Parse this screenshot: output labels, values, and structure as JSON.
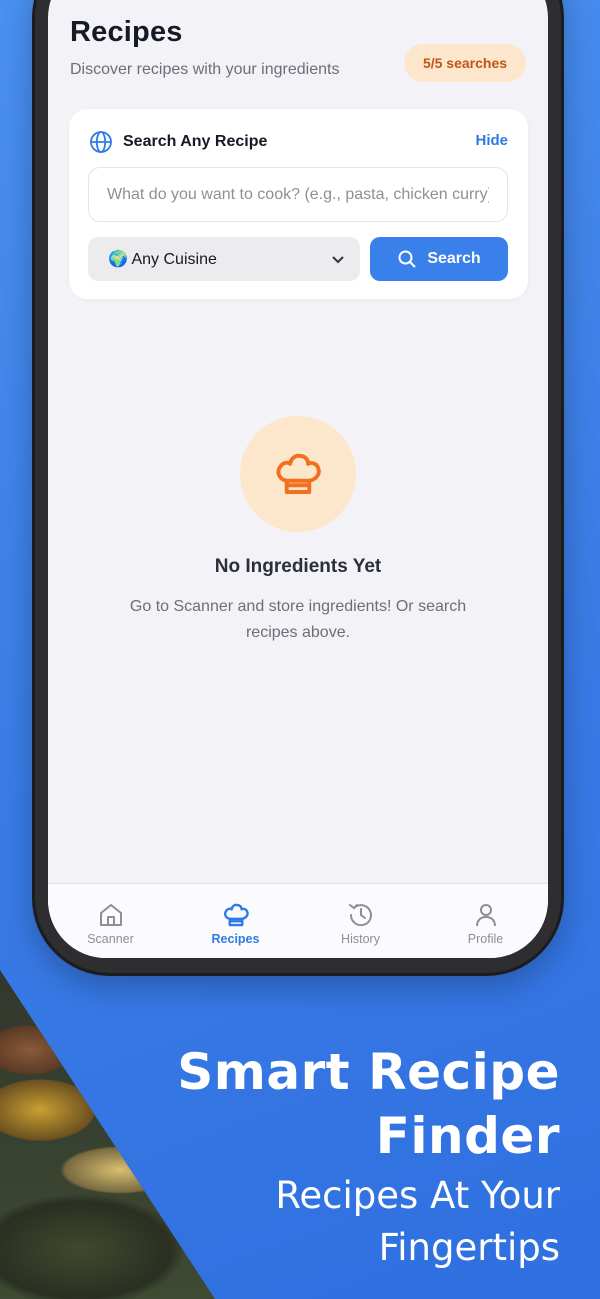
{
  "header": {
    "title": "Recipes",
    "subtitle": "Discover recipes with your ingredients",
    "search_badge": "5/5 searches"
  },
  "search_card": {
    "title": "Search Any Recipe",
    "hide_label": "Hide",
    "input_placeholder": "What do you want to cook? (e.g., pasta, chicken curry)",
    "input_value": "",
    "cuisine_selected": "🌍 Any Cuisine",
    "search_button_label": "Search"
  },
  "empty_state": {
    "icon": "chef-hat-icon",
    "title": "No Ingredients Yet",
    "text": "Go to Scanner and store ingredients! Or search recipes above."
  },
  "tabbar": {
    "items": [
      {
        "label": "Scanner",
        "icon": "home-icon",
        "active": false
      },
      {
        "label": "Recipes",
        "icon": "chef-hat-icon",
        "active": true
      },
      {
        "label": "History",
        "icon": "history-icon",
        "active": false
      },
      {
        "label": "Profile",
        "icon": "user-icon",
        "active": false
      }
    ]
  },
  "promo": {
    "title_line1": "Smart Recipe",
    "title_line2": "Finder",
    "sub_line1": "Recipes At Your",
    "sub_line2": "Fingertips"
  },
  "colors": {
    "accent": "#2f7ae5",
    "badge_bg": "#fde7cc",
    "badge_text": "#c0551a",
    "chef_icon": "#f2701d",
    "background": "#3a7de6"
  }
}
